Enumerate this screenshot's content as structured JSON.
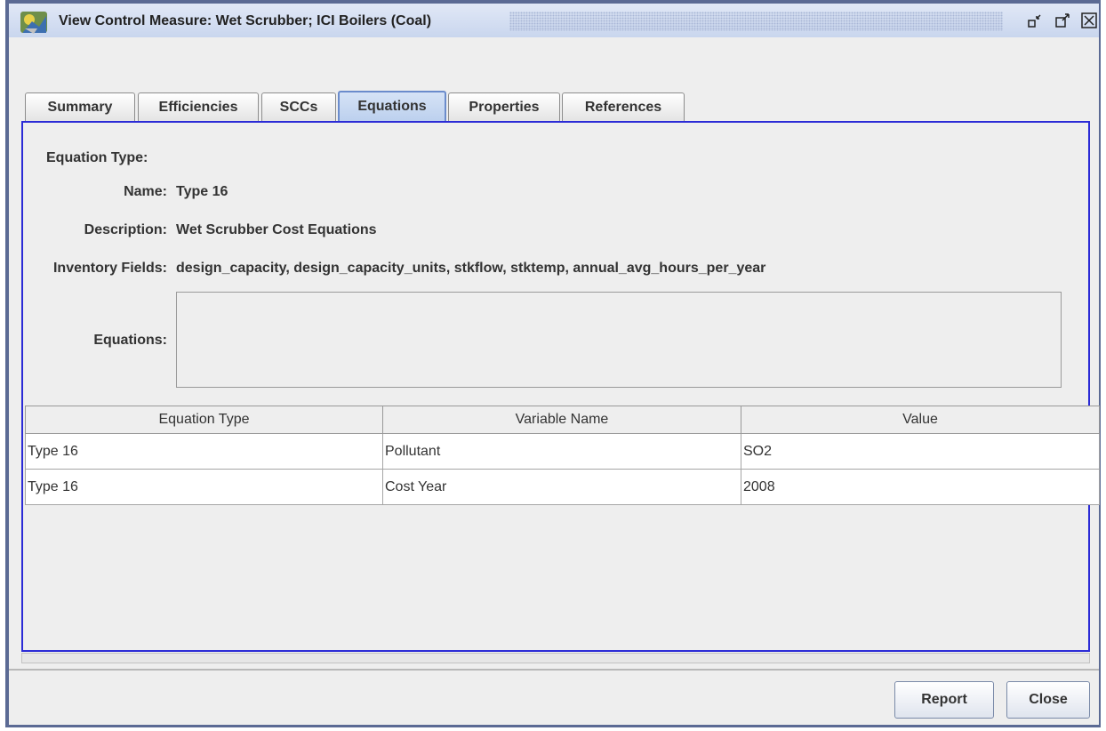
{
  "window": {
    "title": "View Control Measure: Wet Scrubber; ICI Boilers (Coal)",
    "controls": {
      "minimize": "▫↙",
      "maximize": "↗",
      "close": "⊠"
    }
  },
  "tabs": [
    {
      "label": "Summary",
      "active": false
    },
    {
      "label": "Efficiencies",
      "active": false
    },
    {
      "label": "SCCs",
      "active": false
    },
    {
      "label": "Equations",
      "active": true
    },
    {
      "label": "Properties",
      "active": false
    },
    {
      "label": "References",
      "active": false
    }
  ],
  "form": {
    "equation_type_label": "Equation Type:",
    "name_label": "Name:",
    "name_value": "Type 16",
    "description_label": "Description:",
    "description_value": "Wet Scrubber Cost Equations",
    "inventory_fields_label": "Inventory Fields:",
    "inventory_fields_value": "design_capacity, design_capacity_units, stkflow, stktemp, annual_avg_hours_per_year",
    "equations_label": "Equations:",
    "equations_value": ""
  },
  "table": {
    "columns": [
      "Equation Type",
      "Variable Name",
      "Value"
    ],
    "rows": [
      [
        "Type 16",
        "Pollutant",
        "SO2"
      ],
      [
        "Type 16",
        "Cost Year",
        "2008"
      ]
    ]
  },
  "buttons": {
    "report": "Report",
    "close": "Close"
  },
  "colors": {
    "active_border": "#2b2bd6",
    "title_gradient": "#c9d6ee"
  }
}
